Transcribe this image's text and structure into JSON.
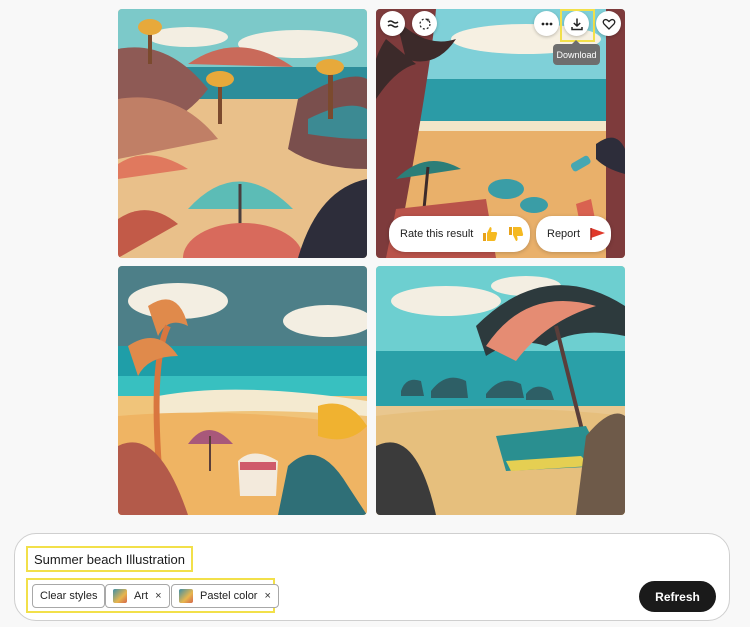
{
  "tooltip": {
    "download": "Download"
  },
  "feedback": {
    "rate_label": "Rate this result",
    "report_label": "Report"
  },
  "prompt": {
    "text": "Summer beach Illustration"
  },
  "styles": {
    "clear_label": "Clear styles",
    "chips": [
      {
        "label": "Art",
        "remove": "×"
      },
      {
        "label": "Pastel color",
        "remove": "×"
      }
    ]
  },
  "actions": {
    "refresh_label": "Refresh"
  },
  "icons": {
    "variation": "variation-icon",
    "similar": "sparkle-similar-icon",
    "more": "more-options-icon",
    "download": "download-icon",
    "favorite": "heart-icon",
    "thumbs_up": "thumbs-up-icon",
    "thumbs_down": "thumbs-down-icon",
    "report": "flag-icon"
  },
  "colors": {
    "highlight": "#f2e04a",
    "refresh_bg": "#1a1a1a",
    "tooltip_bg": "#6e6e6e"
  }
}
